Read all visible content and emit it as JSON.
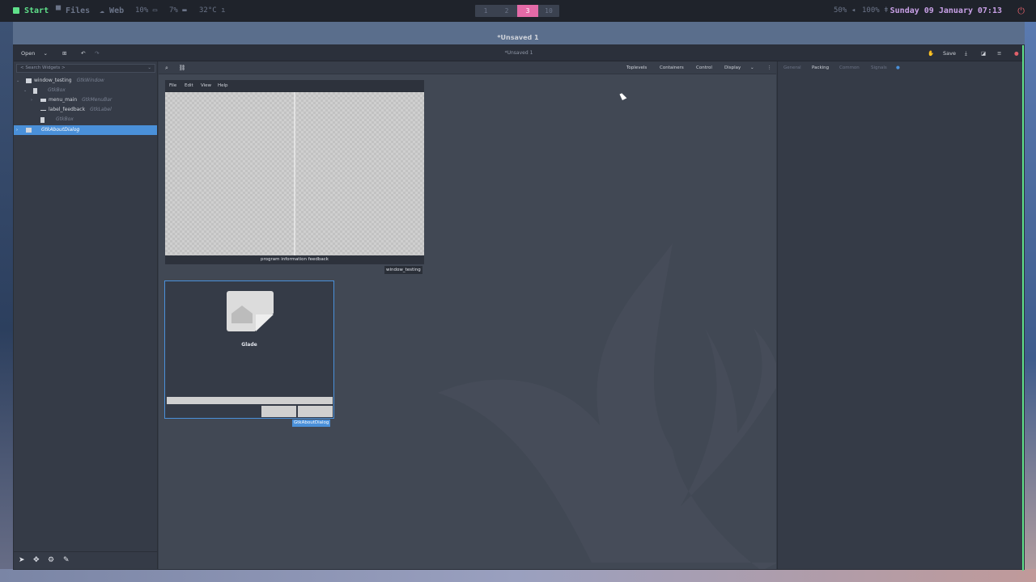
{
  "topbar": {
    "start": "Start",
    "files": "Files",
    "web": "Web",
    "cpu": "10%",
    "mem": "7%",
    "temp": "32°C",
    "workspaces": [
      {
        "label": "1"
      },
      {
        "label": "2"
      },
      {
        "label": "3",
        "active": true
      },
      {
        "label": "10"
      }
    ],
    "brightness": "50%",
    "volume": "100%",
    "date": "Sunday 09 January",
    "time": "07:13"
  },
  "window": {
    "title": "*Unsaved 1",
    "subtitle": "*Unsaved 1"
  },
  "headerbar": {
    "open_label": "Open",
    "save_label": "Save"
  },
  "search": {
    "placeholder": "< Search Widgets >"
  },
  "tree": [
    {
      "name": "window_testing",
      "type": "GtkWindow"
    },
    {
      "name": "",
      "type": "GtkBox"
    },
    {
      "name": "menu_main",
      "type": "GtkMenuBar"
    },
    {
      "name": "label_feedback",
      "type": "GtkLabel"
    },
    {
      "name": "",
      "type": "GtkBox"
    },
    {
      "name": "",
      "type": "GtkAboutDialog",
      "selected": true
    }
  ],
  "palette": {
    "groups": [
      "Toplevels",
      "Containers",
      "Control",
      "Display"
    ]
  },
  "editor": {
    "tabs": [
      "General",
      "Packing",
      "Common",
      "Signals"
    ],
    "active_tab": "Packing"
  },
  "canvas": {
    "window_testing": {
      "menu": [
        "File",
        "Edit",
        "View",
        "Help"
      ],
      "feedback_text": "program information feedback",
      "label": "window_testing"
    },
    "about_dialog": {
      "program_name": "Glade",
      "label": "GtkAboutDialog"
    }
  },
  "colors": {
    "accent": "#4a90d9",
    "start_green": "#5fe08a",
    "workspace_active": "#e36aa7",
    "datetime": "#c8a0e6",
    "power": "#e0606a"
  }
}
